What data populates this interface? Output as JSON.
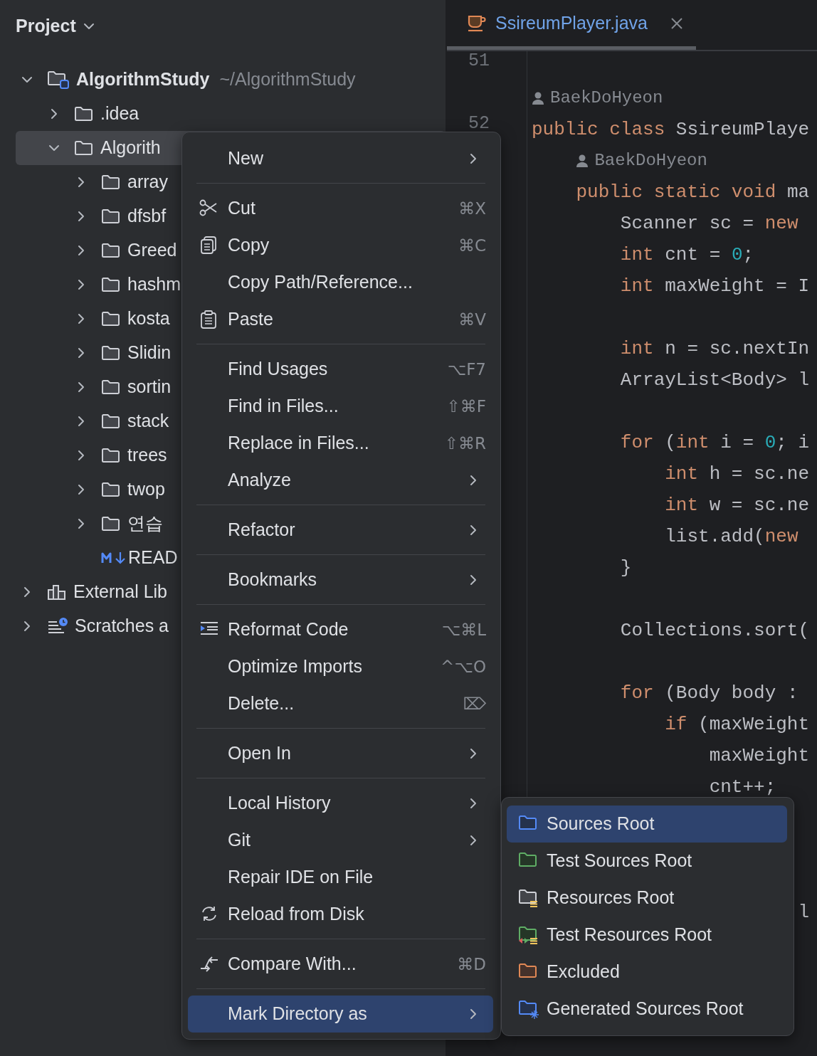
{
  "project_panel": {
    "title": "Project",
    "tree": [
      {
        "kind": "module",
        "label": "AlgorithmStudy",
        "path": "~/AlgorithmStudy",
        "expanded": true,
        "selected": false,
        "children": [
          {
            "kind": "folder",
            "label": ".idea",
            "expanded": false,
            "selected": false
          },
          {
            "kind": "folder",
            "label": "Algorith",
            "expanded": true,
            "selected": true,
            "children": [
              {
                "kind": "folder",
                "label": "array",
                "expanded": false,
                "selected": false
              },
              {
                "kind": "folder",
                "label": "dfsbf",
                "expanded": false,
                "selected": false
              },
              {
                "kind": "folder",
                "label": "Greed",
                "expanded": false,
                "selected": false
              },
              {
                "kind": "folder",
                "label": "hashm",
                "expanded": false,
                "selected": false
              },
              {
                "kind": "folder",
                "label": "kosta",
                "expanded": false,
                "selected": false
              },
              {
                "kind": "folder",
                "label": "Slidin",
                "expanded": false,
                "selected": false
              },
              {
                "kind": "folder",
                "label": "sortin",
                "expanded": false,
                "selected": false
              },
              {
                "kind": "folder",
                "label": "stack",
                "expanded": false,
                "selected": false
              },
              {
                "kind": "folder",
                "label": "trees",
                "expanded": false,
                "selected": false
              },
              {
                "kind": "folder",
                "label": "twop",
                "expanded": false,
                "selected": false
              },
              {
                "kind": "folder",
                "label": "연습",
                "expanded": false,
                "selected": false
              },
              {
                "kind": "markdown",
                "label": "READ",
                "selected": false
              }
            ]
          }
        ]
      },
      {
        "kind": "library",
        "label": "External Lib",
        "expanded": false,
        "selected": false
      },
      {
        "kind": "scratches",
        "label": "Scratches a",
        "expanded": false,
        "selected": false
      }
    ]
  },
  "editor": {
    "tabs": [
      {
        "label": "SsireumPlayer.java",
        "selected": true
      }
    ],
    "lines": [
      {
        "kind": "blank",
        "line_number": "51"
      },
      {
        "kind": "author",
        "text": "BaekDoHyeon"
      },
      {
        "kind": "code",
        "line_number": "52",
        "tokens": [
          {
            "kind": "keyword",
            "text": "public class "
          },
          {
            "kind": "plain",
            "text": "SsireumPlaye"
          }
        ]
      },
      {
        "kind": "author",
        "text": "BaekDoHyeon"
      },
      {
        "kind": "code",
        "tokens": [
          {
            "kind": "keyword",
            "text": "    public static void "
          },
          {
            "kind": "plain",
            "text": "ma"
          }
        ]
      },
      {
        "kind": "code",
        "tokens": [
          {
            "kind": "plain",
            "text": "        Scanner sc = "
          },
          {
            "kind": "keyword",
            "text": "new"
          }
        ]
      },
      {
        "kind": "code",
        "tokens": [
          {
            "kind": "keyword",
            "text": "        int "
          },
          {
            "kind": "plain",
            "text": "cnt = "
          },
          {
            "kind": "number",
            "text": "0"
          },
          {
            "kind": "plain",
            "text": ";"
          }
        ]
      },
      {
        "kind": "code",
        "tokens": [
          {
            "kind": "keyword",
            "text": "        int "
          },
          {
            "kind": "plain",
            "text": "maxWeight = I"
          }
        ]
      },
      {
        "kind": "blank"
      },
      {
        "kind": "code",
        "tokens": [
          {
            "kind": "keyword",
            "text": "        int "
          },
          {
            "kind": "plain",
            "text": "n = sc.nextIn"
          }
        ]
      },
      {
        "kind": "code",
        "tokens": [
          {
            "kind": "plain",
            "text": "        ArrayList<Body> l"
          }
        ]
      },
      {
        "kind": "blank"
      },
      {
        "kind": "code",
        "tokens": [
          {
            "kind": "keyword",
            "text": "        for "
          },
          {
            "kind": "plain",
            "text": "("
          },
          {
            "kind": "keyword",
            "text": "int "
          },
          {
            "kind": "plain",
            "text": "i = "
          },
          {
            "kind": "number",
            "text": "0"
          },
          {
            "kind": "plain",
            "text": "; i"
          }
        ]
      },
      {
        "kind": "code",
        "tokens": [
          {
            "kind": "keyword",
            "text": "            int "
          },
          {
            "kind": "plain",
            "text": "h = sc.ne"
          }
        ]
      },
      {
        "kind": "code",
        "tokens": [
          {
            "kind": "keyword",
            "text": "            int "
          },
          {
            "kind": "plain",
            "text": "w = sc.ne"
          }
        ]
      },
      {
        "kind": "code",
        "tokens": [
          {
            "kind": "plain",
            "text": "            list.add("
          },
          {
            "kind": "keyword",
            "text": "new"
          }
        ]
      },
      {
        "kind": "code",
        "tokens": [
          {
            "kind": "plain",
            "text": "        }"
          }
        ]
      },
      {
        "kind": "blank"
      },
      {
        "kind": "code",
        "tokens": [
          {
            "kind": "plain",
            "text": "        Collections.sort("
          }
        ]
      },
      {
        "kind": "blank"
      },
      {
        "kind": "code",
        "tokens": [
          {
            "kind": "keyword",
            "text": "        for "
          },
          {
            "kind": "plain",
            "text": "(Body body :"
          }
        ]
      },
      {
        "kind": "code",
        "tokens": [
          {
            "kind": "keyword",
            "text": "            if "
          },
          {
            "kind": "plain",
            "text": "(maxWeight"
          }
        ]
      },
      {
        "kind": "code",
        "tokens": [
          {
            "kind": "plain",
            "text": "                maxWeight"
          }
        ]
      },
      {
        "kind": "code",
        "tokens": [
          {
            "kind": "plain",
            "text": "                cnt++;"
          }
        ]
      },
      {
        "kind": "blank"
      },
      {
        "kind": "blank"
      },
      {
        "kind": "blank"
      },
      {
        "kind": "code",
        "tokens": [
          {
            "kind": "plain",
            "text": "                        l"
          }
        ]
      }
    ]
  },
  "context_menu": {
    "items": [
      {
        "kind": "item",
        "label": "New",
        "submenu": true,
        "selected": false
      },
      {
        "kind": "separator"
      },
      {
        "kind": "item",
        "label": "Cut",
        "shortcut": "⌘X",
        "selected": false
      },
      {
        "kind": "item",
        "label": "Copy",
        "shortcut": "⌘C",
        "selected": false
      },
      {
        "kind": "item",
        "label": "Copy Path/Reference...",
        "selected": false
      },
      {
        "kind": "item",
        "label": "Paste",
        "shortcut": "⌘V",
        "selected": false
      },
      {
        "kind": "separator"
      },
      {
        "kind": "item",
        "label": "Find Usages",
        "shortcut": "⌥F7",
        "selected": false
      },
      {
        "kind": "item",
        "label": "Find in Files...",
        "shortcut": "⇧⌘F",
        "selected": false
      },
      {
        "kind": "item",
        "label": "Replace in Files...",
        "shortcut": "⇧⌘R",
        "selected": false
      },
      {
        "kind": "item",
        "label": "Analyze",
        "submenu": true,
        "selected": false
      },
      {
        "kind": "separator"
      },
      {
        "kind": "item",
        "label": "Refactor",
        "submenu": true,
        "selected": false
      },
      {
        "kind": "separator"
      },
      {
        "kind": "item",
        "label": "Bookmarks",
        "submenu": true,
        "selected": false
      },
      {
        "kind": "separator"
      },
      {
        "kind": "item",
        "label": "Reformat Code",
        "shortcut": "⌥⌘L",
        "selected": false
      },
      {
        "kind": "item",
        "label": "Optimize Imports",
        "shortcut": "^⌥O",
        "selected": false
      },
      {
        "kind": "item",
        "label": "Delete...",
        "shortcut": "⌦",
        "selected": false
      },
      {
        "kind": "separator"
      },
      {
        "kind": "item",
        "label": "Open In",
        "submenu": true,
        "selected": false
      },
      {
        "kind": "separator"
      },
      {
        "kind": "item",
        "label": "Local History",
        "submenu": true,
        "selected": false
      },
      {
        "kind": "item",
        "label": "Git",
        "submenu": true,
        "selected": false
      },
      {
        "kind": "item",
        "label": "Repair IDE on File",
        "selected": false
      },
      {
        "kind": "item",
        "label": "Reload from Disk",
        "selected": false
      },
      {
        "kind": "separator"
      },
      {
        "kind": "item",
        "label": "Compare With...",
        "shortcut": "⌘D",
        "selected": false
      },
      {
        "kind": "separator"
      },
      {
        "kind": "item",
        "label": "Mark Directory as",
        "submenu": true,
        "selected": true
      }
    ]
  },
  "submenu": {
    "items": [
      {
        "label": "Sources Root",
        "color": "#548af7",
        "selected": true
      },
      {
        "label": "Test Sources Root",
        "color": "#5fad65",
        "selected": false
      },
      {
        "label": "Resources Root",
        "color": "#ced0d6",
        "selected": false
      },
      {
        "label": "Test Resources Root",
        "color": "#5fad65",
        "selected": false
      },
      {
        "label": "Excluded",
        "color": "#e08855",
        "selected": false
      },
      {
        "label": "Generated Sources Root",
        "color": "#548af7",
        "selected": false
      }
    ]
  }
}
